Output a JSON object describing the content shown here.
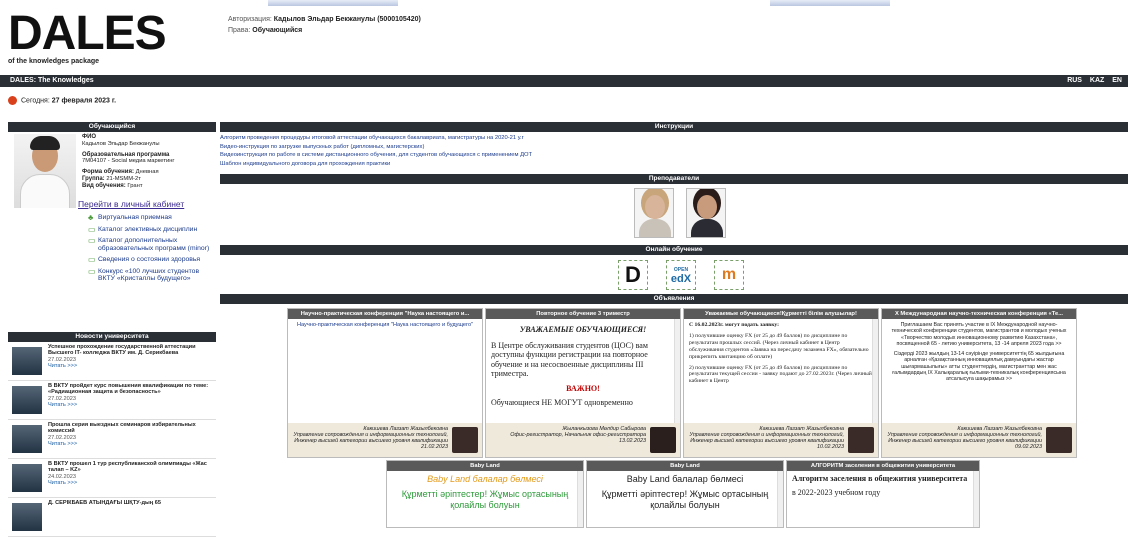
{
  "logo": {
    "text": "DALES",
    "subtitle": "of the knowledges package"
  },
  "auth": {
    "auth_label": "Авторизация:",
    "auth_value": "Кадылов Эльдар Бекжанулы (5000105420)",
    "rights_label": "Права:",
    "rights_value": "Обучающийся"
  },
  "topbar": {
    "brand": "DALES: The Knowledges",
    "langs": [
      "RUS",
      "KAZ",
      "EN"
    ]
  },
  "today": {
    "label": "Сегодня:",
    "value": "27 февраля 2023 г."
  },
  "student": {
    "header": "Обучающийся",
    "fio_label": "ФИО",
    "fio_value": "Кадылов Эльдар Бекжанулы",
    "program_label": "Образовательная программа",
    "program_value": "7M04107 - Social медиа маркетинг",
    "form_label": "Форма обучения:",
    "form_value": "Дневная",
    "group_label": "Группа:",
    "group_value": "21-MSMM-2т",
    "type_label": "Вид обучения:",
    "type_value": "Грант",
    "cabinet_link": "Перейти в личный кабинет"
  },
  "menu": [
    "Виртуальная приемная",
    "Каталог элективных дисциплин",
    "Каталог дополнительных образовательных программ (minor)",
    "Сведения о состоянии здоровья",
    "Конкурс «100 лучших студентов ВКТУ «Кристаллы будущего»"
  ],
  "news": {
    "header": "Новости университета",
    "items": [
      {
        "title": "Успешное прохождение государственной аттестации Высшего IT- колледжа ВКТУ им. Д. Серикбаева",
        "date": "27.02.2023",
        "more": "Читать >>>"
      },
      {
        "title": "В ВКТУ пройдет курс повышения квалификации по теме: «Радиационная защита и безопасность»",
        "date": "27.02.2023",
        "more": "Читать >>>"
      },
      {
        "title": "Прошла серия выездных семинаров избирательных комиссий",
        "date": "27.02.2023",
        "more": "Читать >>>"
      },
      {
        "title": "В ВКТУ прошел 1 тур республиканской олимпиады «Жас талап – KZ»",
        "date": "24.02.2023",
        "more": "Читать >>>"
      },
      {
        "title": "Д. СЕРІКБАЕВ АТЫНДАҒЫ ШҚТУ-дың 65",
        "date": "",
        "more": ""
      }
    ]
  },
  "instructions": {
    "header": "Инструкции",
    "links": [
      "Алгоритм проведения процедуры итоговой аттестации обучающихся бакалавриата, магистратуры на 2020-21 у.г",
      "Видео-инструкция по загрузке выпускных работ (дипломных, магистерских)",
      "Видеоинструкция по работе в системе дистанционного обучения, для студентов обучающихся с применением ДОТ",
      "Шаблон индивидуального договора для прохождения практики"
    ]
  },
  "teachers": {
    "header": "Преподаватели"
  },
  "online": {
    "header": "Онлайн обучение",
    "icons": [
      "D",
      "edX",
      "m"
    ],
    "edx_top": "OPEN"
  },
  "ads": {
    "header": "Объявления"
  },
  "cards": [
    {
      "title": "Научно-практическая конференция \"Наука настоящего и...",
      "body": "Научно-практическая конференция \"Наука настоящего и будущего\"",
      "author": "Какишева Лаззат Жазылбековна",
      "role": "Управление сопровождения и информационных технологий, Инженер высшей категории высшего уровня квалификации",
      "date": "21.02.2023"
    },
    {
      "title": "Повторное обучение 3 триместр",
      "body_head": "УВАЖАЕМЫЕ ОБУЧАЮЩИЕСЯ!",
      "body1": "В Центре обслуживания студентов (ЦОС) вам доступны функции регистрации на повторное обучение и на несосвоенные дисциплины III триместра.",
      "body2": "ВАЖНО!",
      "body3": "Обучающиеся НЕ МОГУТ одновременно",
      "author": "Жыланкызова Мөлдир Сабырова",
      "role": "Офис-регистратор, Начальник офис-регистратора",
      "date": "13.02.2023"
    },
    {
      "title": "Уважаемые обучающиеся!Құрметті білім алушылар!",
      "body1": "С 16.02.2023г. могут подать заявку:",
      "body2": "1) получившие оценку FX (от 25 до 49 баллов) по дисциплине по результатам прошлых сессий. (Через личный кабинет в Центр обслуживания студентов «Заявка на пересдачу экзамена FX», обязательно прикрепить квитанцию об оплате)",
      "body3": "2) получившие оценку FX (от 25 до 49 баллов) по дисциплине по результатам текущей сессии - заявку подают до 27.02.2023г. (Через личный кабинет в Центр",
      "author": "Какишева Лаззат Жазылбековна",
      "role": "Управление сопровождения и информационных технологий, Инженер высшей категории высшего уровня квалификации",
      "date": "10.02.2023"
    },
    {
      "title": "X Международная научно-техническая конференция «Те...",
      "body1": "Приглашаем Вас принять участие в IX Международной научно-технической конференции студентов, магистрантов и молодых ученых «Творчество молодых инновационному развитию Казахстана», посвященной 65 - летию университета, 13 -14 апреля 2023 года >>",
      "body2": "Сіздерді 2023 жылдың 13-14 сәуірінде университеттің 65 жылдығына арналған «Қазақстанның инновациялық дамуындағы жастар шығармашылығы» атты студенттердің, магистранттар мен жас ғалымдардың IX Халықаралық ғылыми-техникалық конференциясына атсалысуға шақырамыз >>",
      "author": "Какишева Лаззат Жазылбековна",
      "role": "Управление сопровождения и информационных технологий, Инженер высшей категории высшего уровня квалификации",
      "date": "09.02.2023"
    }
  ],
  "bottom_cards": [
    {
      "title": "Baby Land",
      "head": "Baby Land балалар бөлмесі",
      "body": "Құрметті әріптестер! Жұмыс ортасының қолайлы болуын"
    },
    {
      "title": "Baby Land",
      "head": "Baby Land балалар бөлмесі",
      "body": "Құрметті әріптестер! Жұмыс ортасының қолайлы болуын"
    },
    {
      "title": "АЛГОРИТМ заселения в общежития университета",
      "head": "Алгоритм заселения в общежития университета",
      "body": "в 2022-2023 учебном году"
    }
  ],
  "colors": {
    "header_bg": "#2a2f36",
    "card_header": "#5a5a5a",
    "green": "#2e9a3a",
    "red": "#c00000"
  }
}
